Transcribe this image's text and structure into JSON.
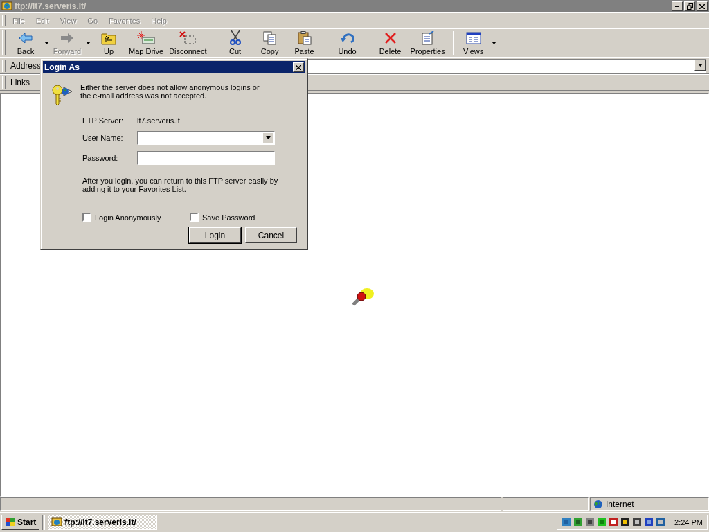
{
  "window": {
    "title": "ftp://lt7.serveris.lt/",
    "active": false
  },
  "menu": [
    {
      "label": "File",
      "disabled": true
    },
    {
      "label": "Edit",
      "disabled": true
    },
    {
      "label": "View",
      "disabled": true
    },
    {
      "label": "Go",
      "disabled": true
    },
    {
      "label": "Favorites",
      "disabled": true
    },
    {
      "label": "Help",
      "disabled": true
    }
  ],
  "toolbar": {
    "groups": [
      {
        "buttons": [
          {
            "label": "Back",
            "kind": "back",
            "disabled": false,
            "dropdown": true
          },
          {
            "label": "Forward",
            "kind": "forward",
            "disabled": true,
            "dropdown": true
          },
          {
            "label": "Up",
            "kind": "up",
            "disabled": false,
            "dropdown": false
          },
          {
            "label": "Map Drive",
            "kind": "map-drive",
            "disabled": false,
            "dropdown": false
          },
          {
            "label": "Disconnect",
            "kind": "disconnect",
            "disabled": false,
            "dropdown": false
          }
        ]
      },
      {
        "buttons": [
          {
            "label": "Cut",
            "kind": "cut",
            "disabled": false,
            "dropdown": false
          },
          {
            "label": "Copy",
            "kind": "copy",
            "disabled": false,
            "dropdown": false
          },
          {
            "label": "Paste",
            "kind": "paste",
            "disabled": false,
            "dropdown": false
          }
        ]
      },
      {
        "buttons": [
          {
            "label": "Undo",
            "kind": "undo",
            "disabled": false,
            "dropdown": false
          }
        ]
      },
      {
        "buttons": [
          {
            "label": "Delete",
            "kind": "delete",
            "disabled": false,
            "dropdown": false
          },
          {
            "label": "Properties",
            "kind": "properties",
            "disabled": false,
            "dropdown": false
          }
        ]
      },
      {
        "buttons": [
          {
            "label": "Views",
            "kind": "views",
            "disabled": false,
            "dropdown": true
          }
        ]
      }
    ]
  },
  "address": {
    "label": "Address"
  },
  "links": {
    "label": "Links"
  },
  "dialog": {
    "title": "Login As",
    "message": "Either the server does not allow anonymous logins or the e-mail address was not accepted.",
    "server_label": "FTP Server:",
    "server": "lt7.serveris.lt",
    "fields": [
      {
        "label": "User Name:",
        "kind": "combo"
      },
      {
        "label": "Password:",
        "kind": "text"
      }
    ],
    "note": "After you login, you can return to this FTP server easily by adding it to your Favorites List.",
    "checkboxes": [
      {
        "label": "Login Anonymously",
        "checked": false
      },
      {
        "label": "Save Password",
        "checked": false
      }
    ],
    "buttons": [
      {
        "label": "Login",
        "default": true
      },
      {
        "label": "Cancel",
        "default": false
      }
    ]
  },
  "status_bar": {
    "zone": "Internet"
  },
  "taskbar": {
    "start": "Start",
    "tasks": [
      {
        "label": "ftp://lt7.serveris.lt/",
        "selected": true
      }
    ],
    "clock": "2:24 PM"
  }
}
